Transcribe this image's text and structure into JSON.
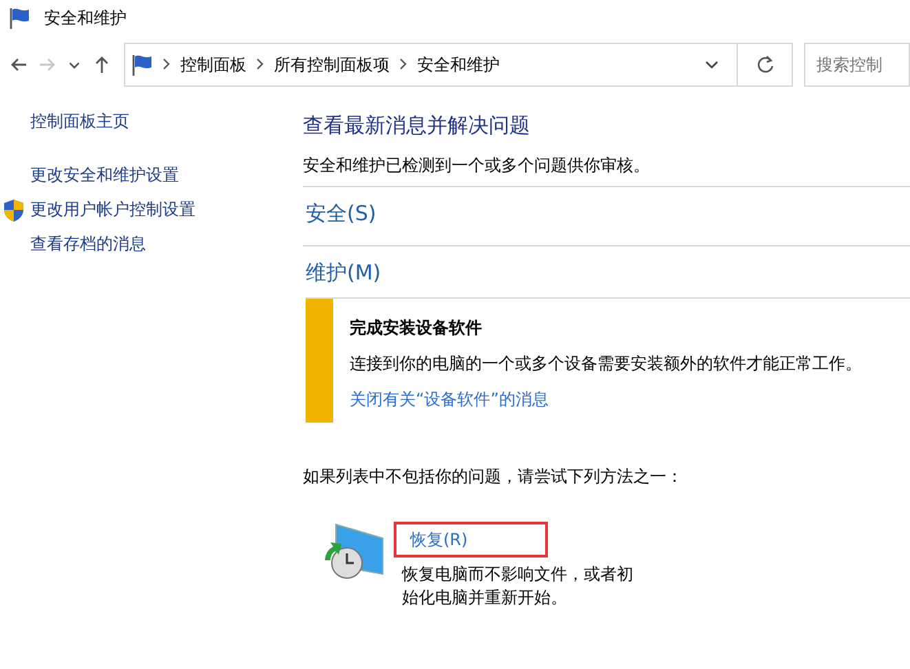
{
  "window": {
    "title": "安全和维护"
  },
  "nav": [
    {
      "kind": "back",
      "disabled": false
    },
    {
      "kind": "forward",
      "disabled": true
    },
    {
      "kind": "recent",
      "disabled": false
    },
    {
      "kind": "up",
      "disabled": false
    }
  ],
  "address": {
    "crumbs": [
      "控制面板",
      "所有控制面板项",
      "安全和维护"
    ]
  },
  "search": {
    "placeholder": "搜索控制"
  },
  "sidebar": {
    "items": [
      {
        "label": "控制面板主页",
        "kind": "home"
      },
      {
        "label": "更改安全和维护设置",
        "kind": "link"
      },
      {
        "label": "更改用户帐户控制设置",
        "kind": "shield"
      },
      {
        "label": "查看存档的消息",
        "kind": "link"
      }
    ]
  },
  "main": {
    "heading": "查看最新消息并解决问题",
    "intro": "安全和维护已检测到一个或多个问题供你审核。",
    "sections": [
      {
        "label": "安全(S)"
      },
      {
        "label": "维护(M)",
        "alerts": [
          {
            "color": "#f2b200",
            "title": "完成安装设备软件",
            "text": "连接到你的电脑的一个或多个设备需要安装额外的软件才能正常工作。",
            "link": "关闭有关“设备软件”的消息"
          }
        ]
      }
    ],
    "suggestion": "如果列表中不包括你的问题，请尝试下列方法之一：",
    "options": [
      {
        "label": "恢复(R)",
        "description": "恢复电脑而不影响文件，或者初始化电脑并重新开始。",
        "highlighted": true
      }
    ]
  }
}
